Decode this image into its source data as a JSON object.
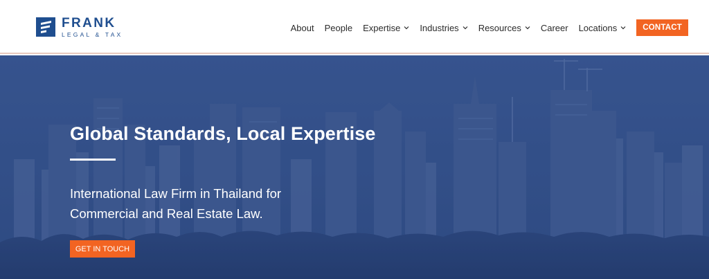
{
  "brand": {
    "name": "FRANK",
    "tagline": "LEGAL & TAX",
    "color": "#1f4e8f",
    "logo_icon": "flag-icon"
  },
  "nav": {
    "items": [
      {
        "label": "About",
        "has_dropdown": false
      },
      {
        "label": "People",
        "has_dropdown": false
      },
      {
        "label": "Expertise",
        "has_dropdown": true
      },
      {
        "label": "Industries",
        "has_dropdown": true
      },
      {
        "label": "Resources",
        "has_dropdown": true
      },
      {
        "label": "Career",
        "has_dropdown": false
      },
      {
        "label": "Locations",
        "has_dropdown": true
      }
    ],
    "contact_label": "CONTACT",
    "dropdown_icon": "chevron-down-icon"
  },
  "hero": {
    "title": "Global Standards, Local Expertise",
    "subtitle_lines": [
      "International Law Firm in Thailand for",
      "Commercial and Real Estate Law."
    ],
    "cta_label": "GET IN TOUCH",
    "background": "city-skyline-image"
  },
  "colors": {
    "accent": "#f26422",
    "hero_overlay": "#34508a",
    "header_bg": "#ffffff"
  }
}
